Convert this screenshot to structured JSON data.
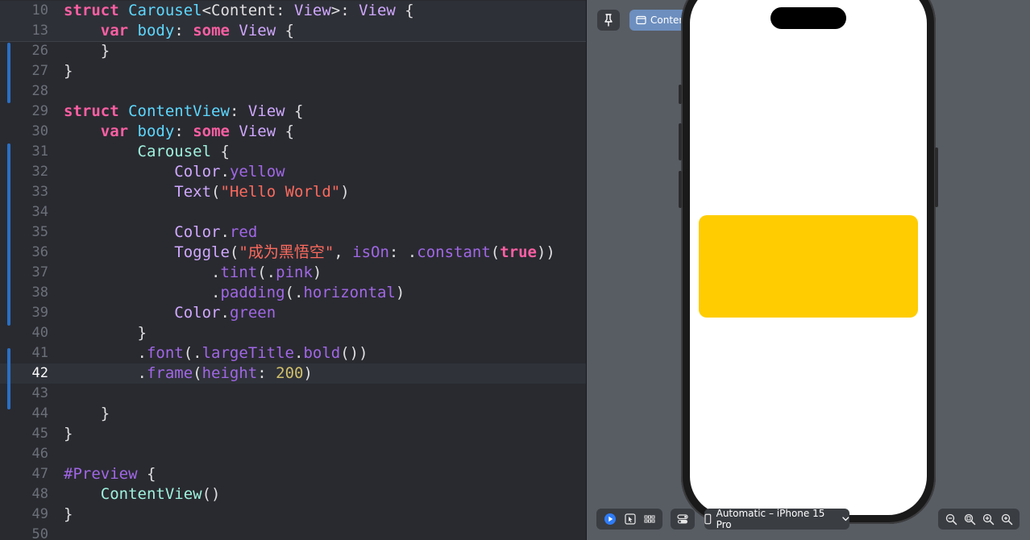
{
  "editor": {
    "lines": [
      {
        "num": "10",
        "sticky": true,
        "tokens": [
          [
            "kw",
            "struct"
          ],
          [
            "plain",
            " "
          ],
          [
            "ty",
            "Carousel"
          ],
          [
            "plain",
            "<Content: "
          ],
          [
            "tyo",
            "View"
          ],
          [
            "plain",
            ">: "
          ],
          [
            "tyo",
            "View"
          ],
          [
            "plain",
            " {"
          ]
        ]
      },
      {
        "num": "13",
        "sticky": true,
        "tokens": [
          [
            "plain",
            "    "
          ],
          [
            "kw",
            "var"
          ],
          [
            "plain",
            " "
          ],
          [
            "ty",
            "body"
          ],
          [
            "plain",
            ": "
          ],
          [
            "kw",
            "some"
          ],
          [
            "plain",
            " "
          ],
          [
            "tyo",
            "View"
          ],
          [
            "plain",
            " {"
          ]
        ]
      },
      {
        "num": "26",
        "tokens": [
          [
            "plain",
            "    }"
          ]
        ]
      },
      {
        "num": "27",
        "tokens": [
          [
            "plain",
            "}"
          ]
        ]
      },
      {
        "num": "28",
        "tokens": []
      },
      {
        "num": "29",
        "tokens": [
          [
            "kw",
            "struct"
          ],
          [
            "plain",
            " "
          ],
          [
            "ty",
            "ContentView"
          ],
          [
            "plain",
            ": "
          ],
          [
            "tyo",
            "View"
          ],
          [
            "plain",
            " {"
          ]
        ]
      },
      {
        "num": "30",
        "tokens": [
          [
            "plain",
            "    "
          ],
          [
            "kw",
            "var"
          ],
          [
            "plain",
            " "
          ],
          [
            "ty",
            "body"
          ],
          [
            "plain",
            ": "
          ],
          [
            "kw",
            "some"
          ],
          [
            "plain",
            " "
          ],
          [
            "tyo",
            "View"
          ],
          [
            "plain",
            " {"
          ]
        ]
      },
      {
        "num": "31",
        "tokens": [
          [
            "plain",
            "        "
          ],
          [
            "cls",
            "Carousel"
          ],
          [
            "plain",
            " {"
          ]
        ]
      },
      {
        "num": "32",
        "tokens": [
          [
            "plain",
            "            "
          ],
          [
            "tyo",
            "Color"
          ],
          [
            "plain",
            "."
          ],
          [
            "mem",
            "yellow"
          ]
        ]
      },
      {
        "num": "33",
        "tokens": [
          [
            "plain",
            "            "
          ],
          [
            "tyo",
            "Text"
          ],
          [
            "plain",
            "("
          ],
          [
            "str",
            "\"Hello World\""
          ],
          [
            "plain",
            ")"
          ]
        ]
      },
      {
        "num": "34",
        "tokens": []
      },
      {
        "num": "35",
        "tokens": [
          [
            "plain",
            "            "
          ],
          [
            "tyo",
            "Color"
          ],
          [
            "plain",
            "."
          ],
          [
            "mem",
            "red"
          ]
        ]
      },
      {
        "num": "36",
        "tokens": [
          [
            "plain",
            "            "
          ],
          [
            "tyo",
            "Toggle"
          ],
          [
            "plain",
            "("
          ],
          [
            "str",
            "\"成为黑悟空\""
          ],
          [
            "plain",
            ", "
          ],
          [
            "fn",
            "isOn"
          ],
          [
            "plain",
            ": ."
          ],
          [
            "mem",
            "constant"
          ],
          [
            "plain",
            "("
          ],
          [
            "kw",
            "true"
          ],
          [
            "plain",
            "))"
          ]
        ]
      },
      {
        "num": "37",
        "tokens": [
          [
            "plain",
            "                ."
          ],
          [
            "mem",
            "tint"
          ],
          [
            "plain",
            "(."
          ],
          [
            "mem",
            "pink"
          ],
          [
            "plain",
            ")"
          ]
        ]
      },
      {
        "num": "38",
        "tokens": [
          [
            "plain",
            "                ."
          ],
          [
            "mem",
            "padding"
          ],
          [
            "plain",
            "(."
          ],
          [
            "mem",
            "horizontal"
          ],
          [
            "plain",
            ")"
          ]
        ]
      },
      {
        "num": "39",
        "tokens": [
          [
            "plain",
            "            "
          ],
          [
            "tyo",
            "Color"
          ],
          [
            "plain",
            "."
          ],
          [
            "mem",
            "green"
          ]
        ]
      },
      {
        "num": "40",
        "tokens": [
          [
            "plain",
            "        }"
          ]
        ]
      },
      {
        "num": "41",
        "tokens": [
          [
            "plain",
            "        ."
          ],
          [
            "mem",
            "font"
          ],
          [
            "plain",
            "(."
          ],
          [
            "mem",
            "largeTitle"
          ],
          [
            "plain",
            "."
          ],
          [
            "mem",
            "bold"
          ],
          [
            "plain",
            "())"
          ]
        ]
      },
      {
        "num": "42",
        "current": true,
        "tokens": [
          [
            "plain",
            "        ."
          ],
          [
            "mem",
            "frame"
          ],
          [
            "plain",
            "("
          ],
          [
            "fn",
            "height"
          ],
          [
            "plain",
            ": "
          ],
          [
            "num",
            "200"
          ],
          [
            "plain",
            ")"
          ]
        ]
      },
      {
        "num": "43",
        "tokens": []
      },
      {
        "num": "44",
        "tokens": [
          [
            "plain",
            "    }"
          ]
        ]
      },
      {
        "num": "45",
        "tokens": [
          [
            "plain",
            "}"
          ]
        ]
      },
      {
        "num": "46",
        "tokens": []
      },
      {
        "num": "47",
        "tokens": [
          [
            "mac",
            "#Preview"
          ],
          [
            "plain",
            " {"
          ]
        ]
      },
      {
        "num": "48",
        "tokens": [
          [
            "plain",
            "    "
          ],
          [
            "cls",
            "ContentView"
          ],
          [
            "plain",
            "()"
          ]
        ]
      },
      {
        "num": "49",
        "tokens": [
          [
            "plain",
            "}"
          ]
        ]
      },
      {
        "num": "50",
        "tokens": []
      }
    ]
  },
  "preview": {
    "tab_label": "ContentView",
    "device_label": "Automatic – iPhone 15 Pro",
    "icons": {
      "pin": "pin-icon",
      "tab": "window-icon",
      "live": "play-icon",
      "select": "cursor-select-icon",
      "variants": "grid-icon",
      "settings": "toggle-settings-icon",
      "device": "iphone-icon",
      "chevron": "chevron-down-icon",
      "zoom_out": "zoom-out-icon",
      "zoom_fit": "zoom-fit-icon",
      "zoom_in": "zoom-in-icon",
      "zoom_actual": "zoom-actual-icon"
    },
    "rendered_color": "#fecc00"
  }
}
